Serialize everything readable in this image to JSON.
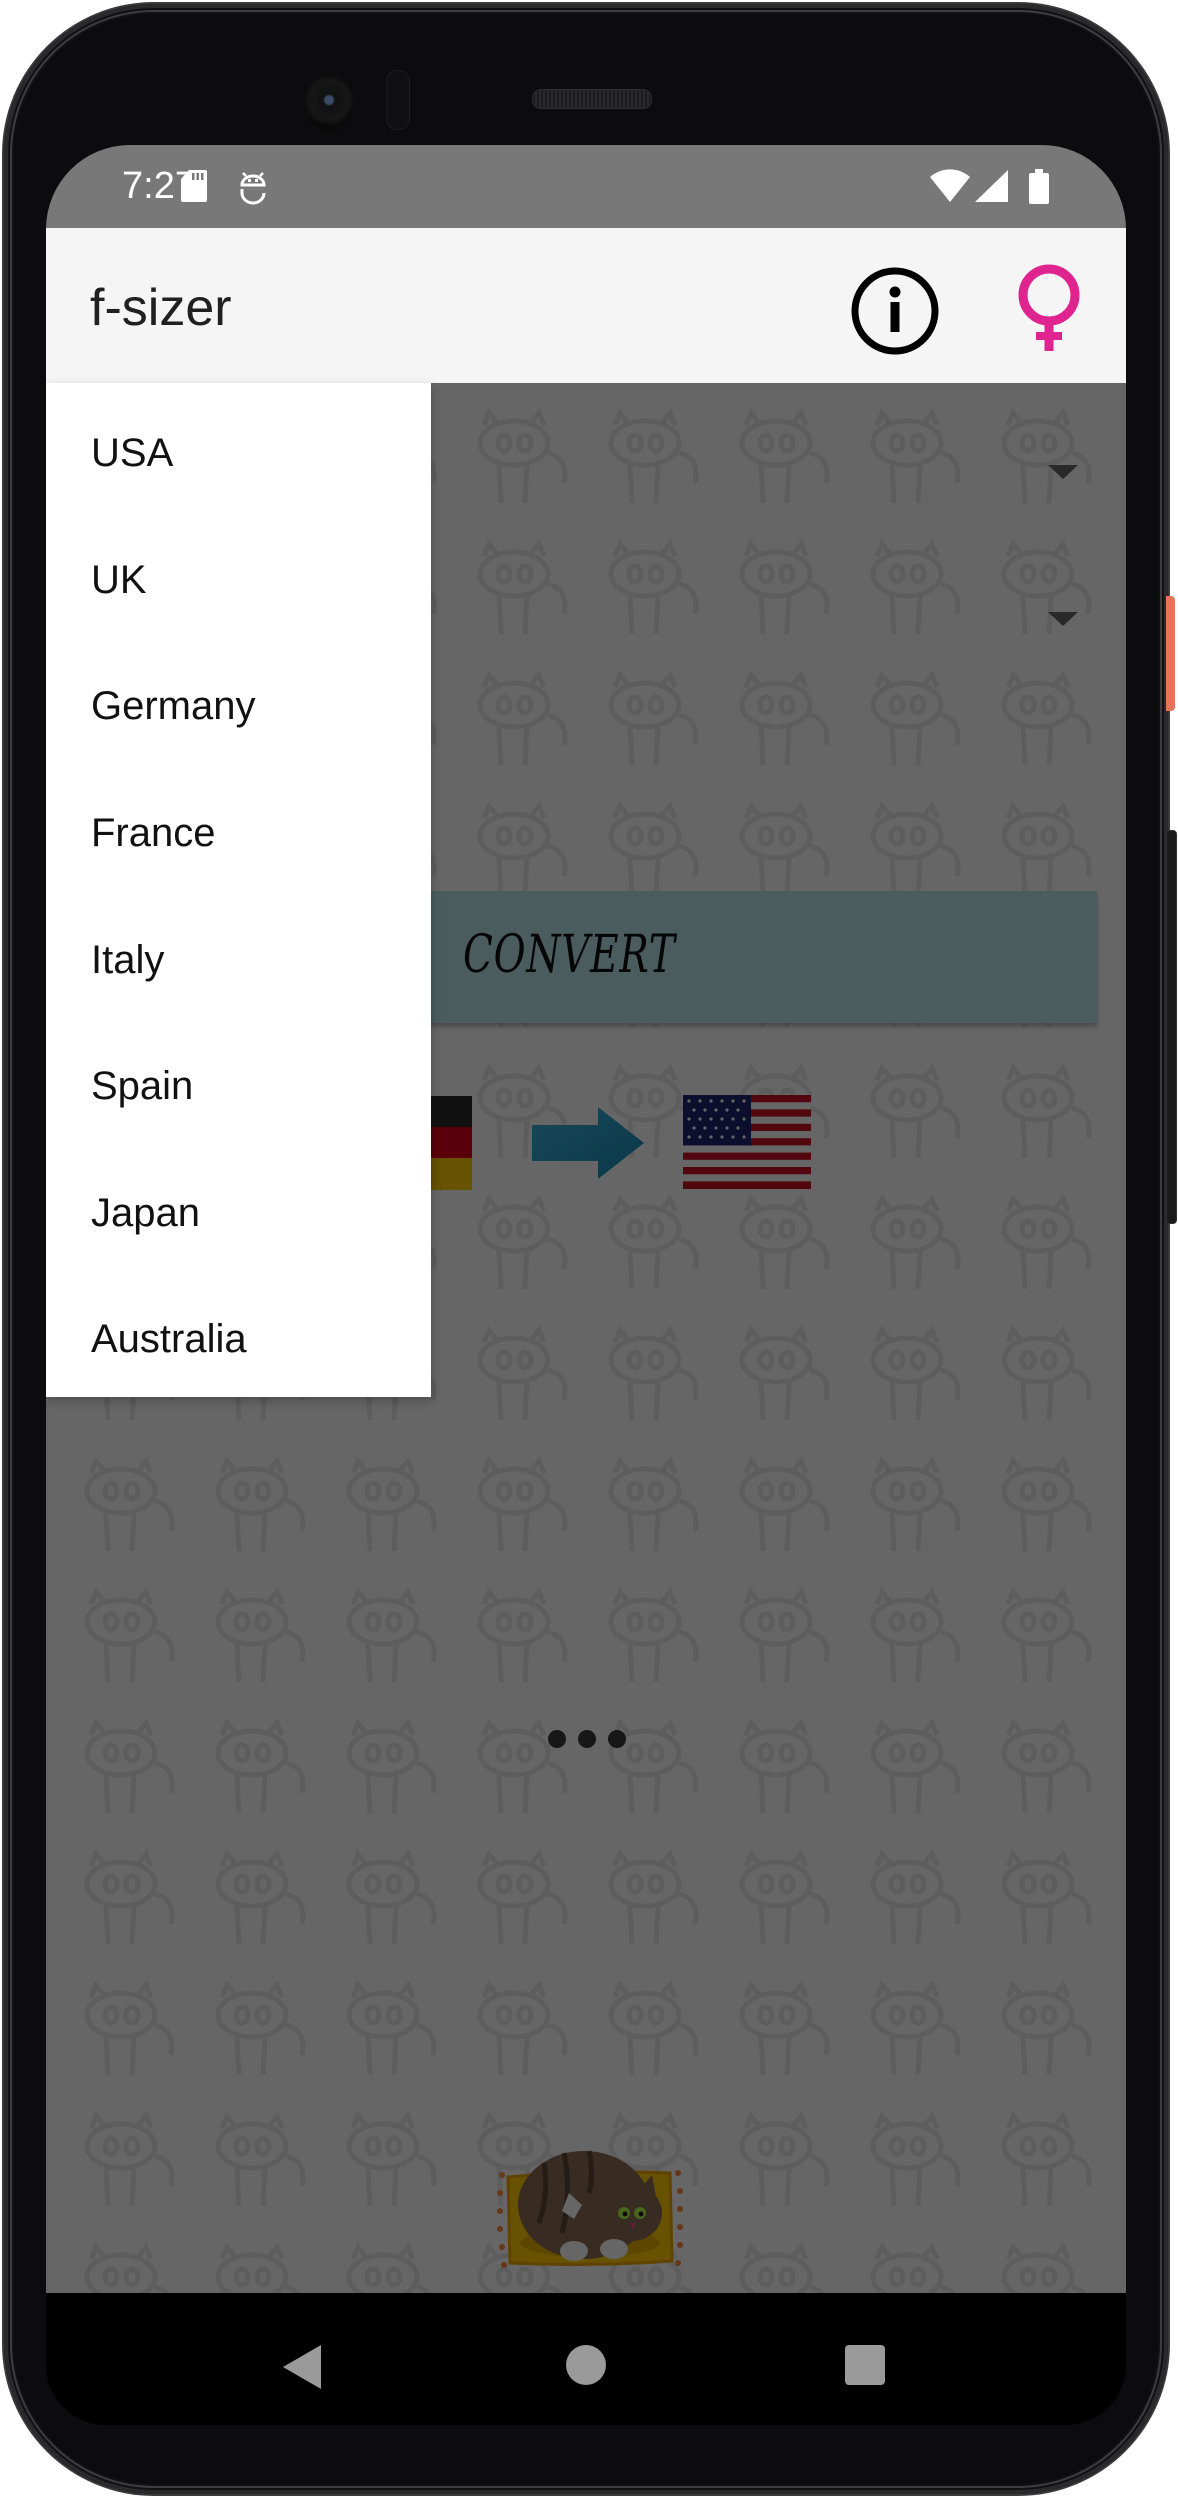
{
  "status_bar": {
    "time": "7:27",
    "left_icons": [
      "sd-card-icon",
      "android-debug-icon"
    ],
    "right_icons": [
      "wifi-icon",
      "cellular-signal-icon",
      "battery-icon"
    ]
  },
  "app_bar": {
    "title": "f-sizer",
    "actions": [
      {
        "name": "info-icon",
        "color": "#000000"
      },
      {
        "name": "female-gender-icon",
        "color": "#e0248f"
      }
    ]
  },
  "main": {
    "spinners": [
      {
        "name": "from-country-spinner",
        "icon": "dropdown-arrow-icon"
      },
      {
        "name": "to-country-spinner",
        "icon": "dropdown-arrow-icon"
      }
    ],
    "convert_button": {
      "label": "CONVERT",
      "color": "#b9e6eb"
    },
    "conversion_preview": {
      "from_flag": "germany-flag",
      "arrow": "right-arrow-icon",
      "to_flag": "usa-flag"
    },
    "loading_indicator": "more-dots-icon",
    "footer_image": "cat-on-pillow-image",
    "background_pattern": "cat-silhouette-pattern"
  },
  "dropdown": {
    "items": [
      {
        "label": "USA"
      },
      {
        "label": "UK"
      },
      {
        "label": "Germany"
      },
      {
        "label": "France"
      },
      {
        "label": "Italy"
      },
      {
        "label": "Spain"
      },
      {
        "label": "Japan"
      },
      {
        "label": "Australia"
      }
    ]
  },
  "nav_bar": {
    "buttons": [
      "back-icon",
      "home-icon",
      "recents-icon"
    ]
  }
}
